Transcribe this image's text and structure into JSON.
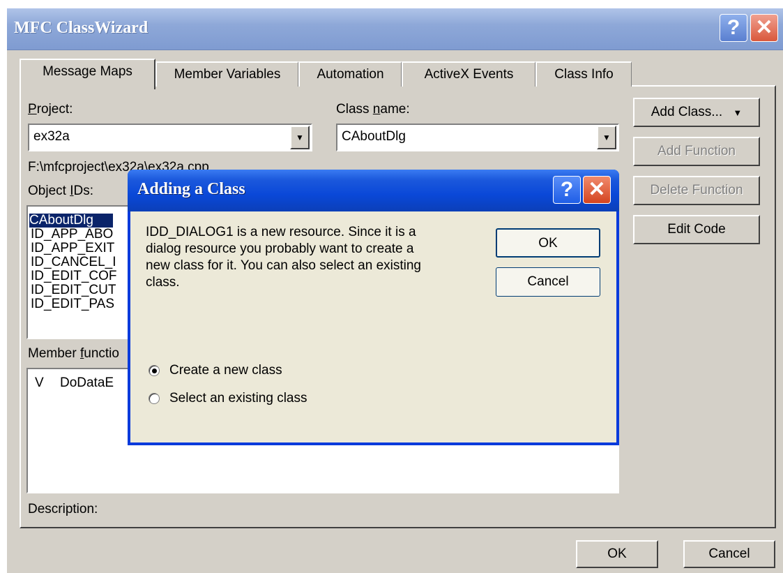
{
  "main_window": {
    "title": "MFC ClassWizard",
    "help_glyph": "?",
    "close_glyph": "✕"
  },
  "tabs": [
    {
      "label": "Message Maps",
      "active": true
    },
    {
      "label": "Member Variables"
    },
    {
      "label": "Automation"
    },
    {
      "label": "ActiveX Events"
    },
    {
      "label": "Class Info"
    }
  ],
  "project": {
    "label_prefix": "",
    "label_underline": "P",
    "label_rest": "roject:",
    "value": "ex32a"
  },
  "class_name": {
    "label_prefix": "Class ",
    "label_underline": "n",
    "label_rest": "ame:",
    "value": "CAboutDlg"
  },
  "file_path": "F:\\mfcproject\\ex32a\\ex32a.cpp",
  "object_ids": {
    "label_prefix": "Object ",
    "label_underline": "I",
    "label_rest": "Ds:",
    "items": [
      "CAboutDlg",
      "ID_APP_ABO",
      "ID_APP_EXIT",
      "ID_CANCEL_I",
      "ID_EDIT_COF",
      "ID_EDIT_CUT",
      "ID_EDIT_PAS"
    ]
  },
  "member_functions": {
    "label_prefix": "Member ",
    "label_underline": "f",
    "label_rest": "unctio",
    "rows": [
      {
        "flag": "V",
        "name": "DoDataE"
      }
    ]
  },
  "description_label": "Description:",
  "side_buttons": {
    "add_class": "Add Class...",
    "add_class_arrow": "▼",
    "add_function": "Add Function",
    "delete_function": "Delete Function",
    "edit_code": "Edit Code"
  },
  "footer": {
    "ok": "OK",
    "cancel": "Cancel"
  },
  "dialog": {
    "title": "Adding a Class",
    "help_glyph": "?",
    "close_glyph": "✕",
    "message_lines": [
      "IDD_DIALOG1 is a new resource.  Since it is a",
      "dialog resource you probably want to create a",
      "new class for it.  You can also select an existing",
      "class."
    ],
    "ok": "OK",
    "cancel": "Cancel",
    "options": [
      {
        "label": "Create a new class",
        "selected": true
      },
      {
        "label": "Select an existing class",
        "selected": false
      }
    ]
  },
  "colors": {
    "dialog_title_blue": "#0a48d8",
    "selection_blue": "#0a246a",
    "face": "#d4d0c8"
  }
}
